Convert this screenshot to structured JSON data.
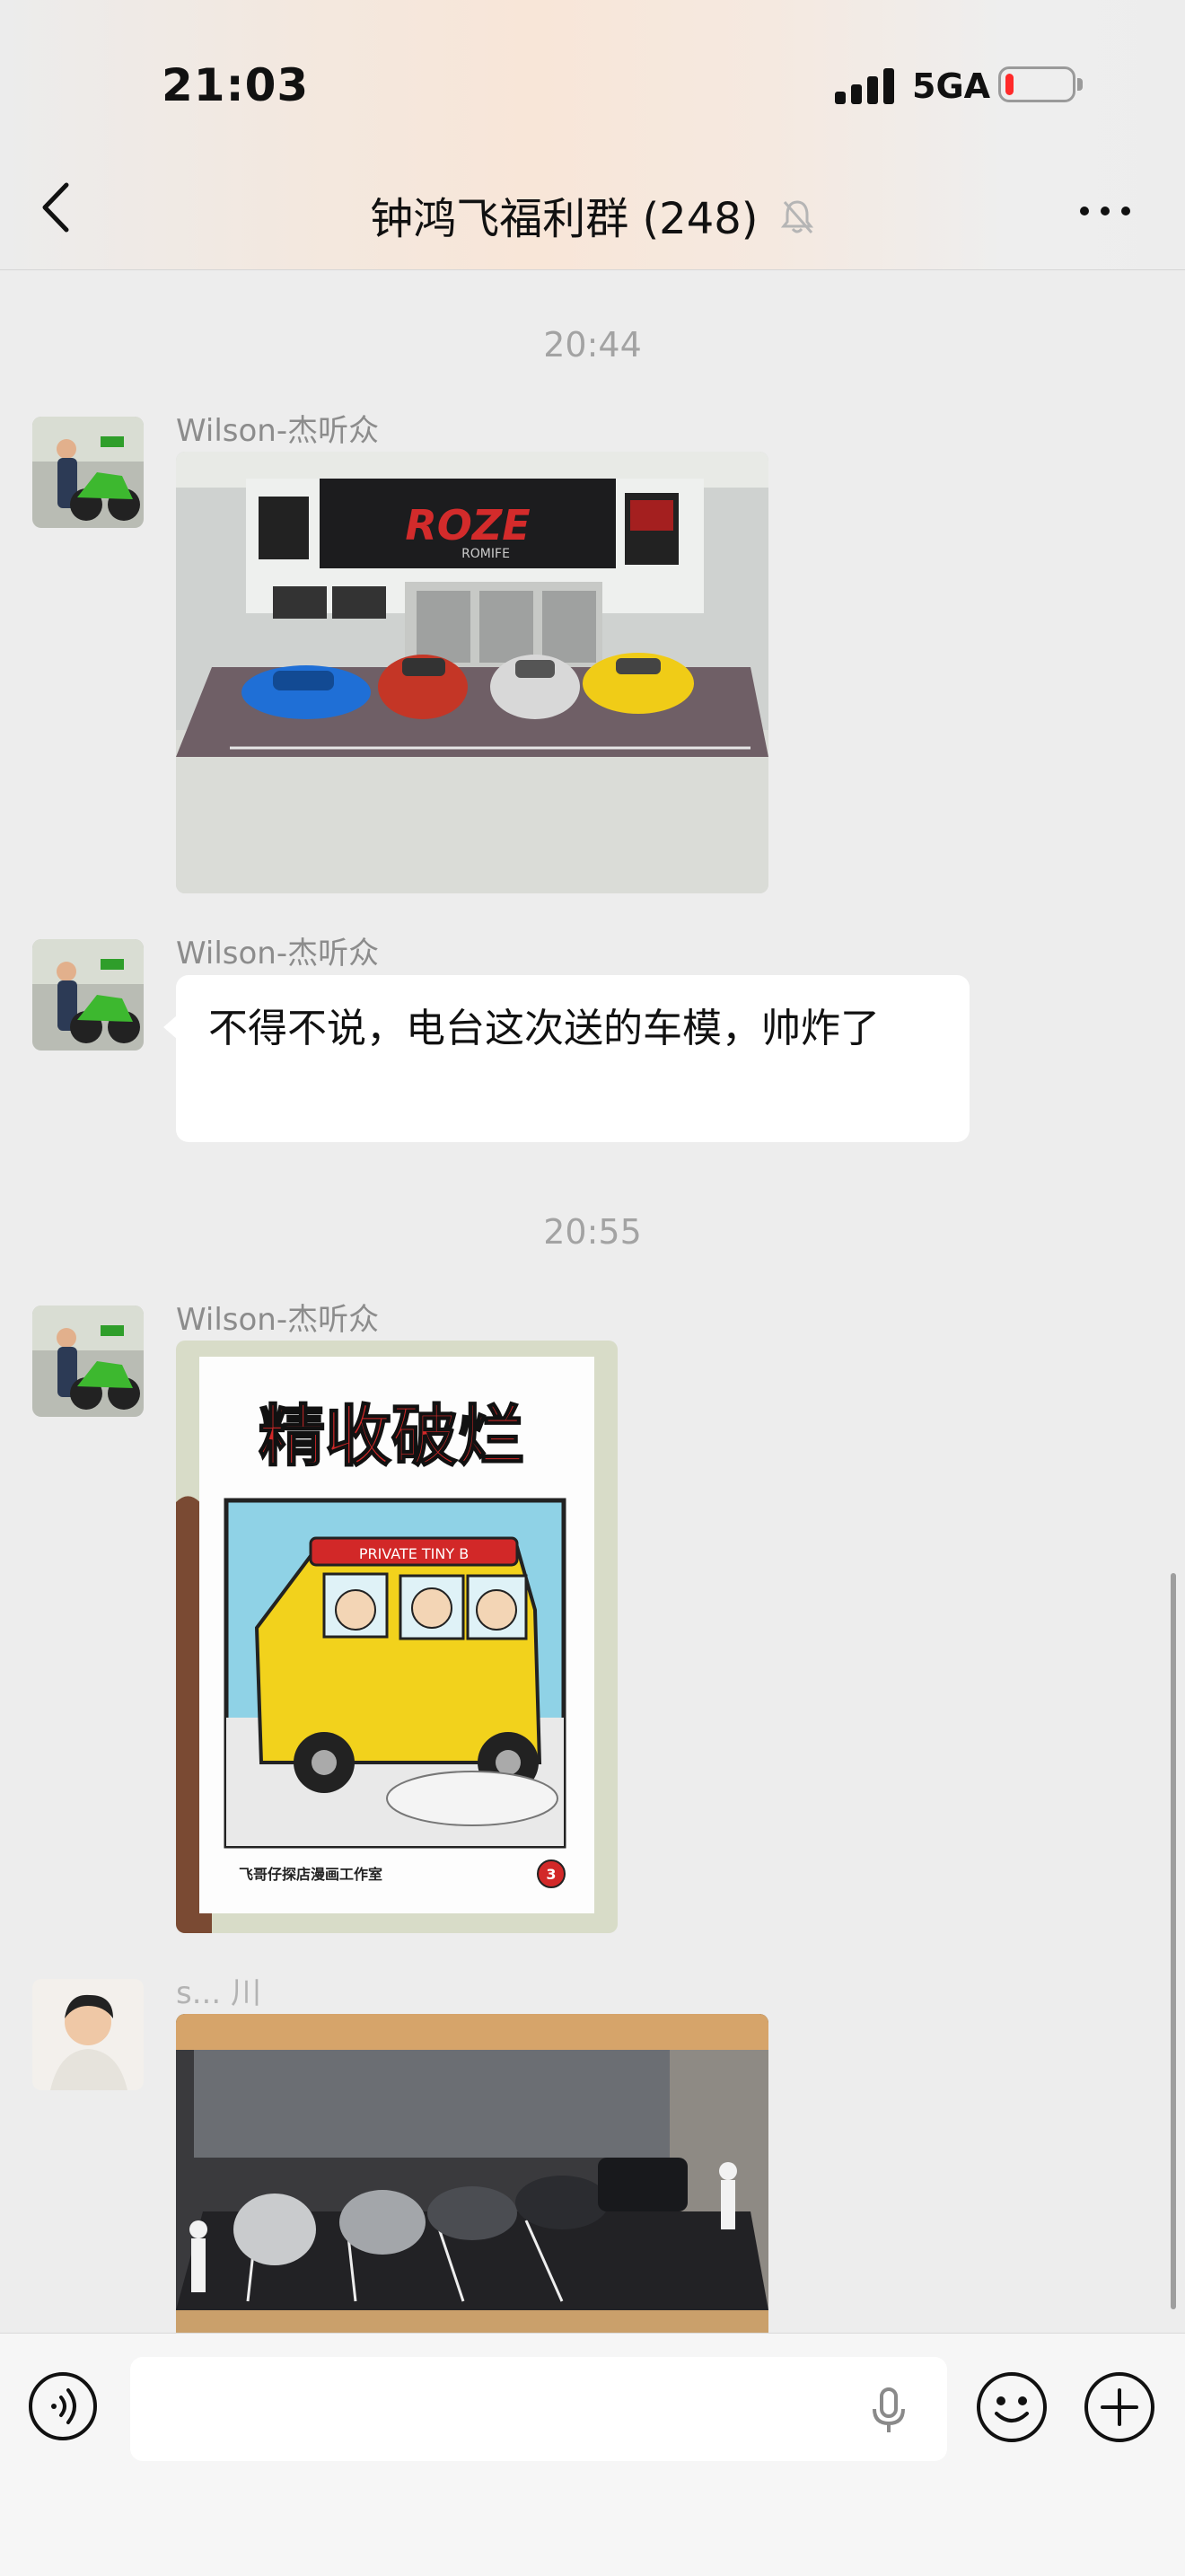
{
  "status_bar": {
    "time": "21:03",
    "network": "5GA",
    "battery_level": 0.12
  },
  "header": {
    "title": "钟鸿飞福利群 (248)",
    "muted": true
  },
  "messages": [
    {
      "type": "time",
      "text": "20:44"
    },
    {
      "type": "image",
      "sender": "Wilson-杰听众",
      "sign_text": "ROZE",
      "sign_sub": "ROMIFE"
    },
    {
      "type": "text",
      "sender": "Wilson-杰听众",
      "text": "不得不说，电台这次送的车模，帅炸了"
    },
    {
      "type": "time",
      "text": "20:55"
    },
    {
      "type": "image",
      "sender": "Wilson-杰听众",
      "book_title": "精收破烂",
      "banner": "PRIVATE TINY B",
      "footer": "飞哥仔探店漫画工作室",
      "badge": "3"
    },
    {
      "type": "image",
      "sender": "s... 川"
    }
  ],
  "input_bar": {
    "placeholder": ""
  },
  "colors": {
    "background": "#ededed",
    "bubble": "#ffffff",
    "time_text": "#a3a3a3"
  }
}
